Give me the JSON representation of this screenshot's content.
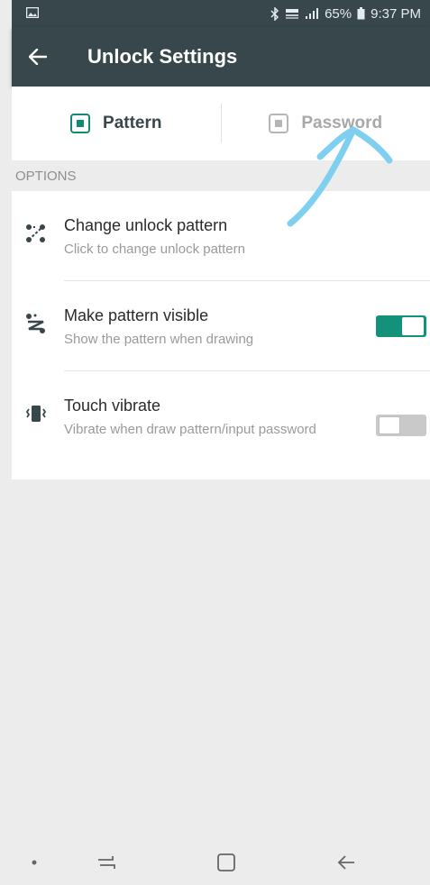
{
  "status_bar": {
    "battery": "65%",
    "time": "9:37 PM",
    "icons": [
      "gallery-icon",
      "bluetooth-icon",
      "lte-icon",
      "signal-icon",
      "battery-icon"
    ]
  },
  "app_bar": {
    "title": "Unlock Settings",
    "back_icon": "arrow-left-icon"
  },
  "tabs": [
    {
      "label": "Pattern",
      "active": true
    },
    {
      "label": "Password",
      "active": false
    }
  ],
  "section": {
    "title": "OPTIONS"
  },
  "options": [
    {
      "title": "Change unlock pattern",
      "subtitle": "Click to change unlock pattern",
      "icon": "pattern-icon"
    },
    {
      "title": "Make pattern visible",
      "subtitle": "Show the pattern when drawing",
      "icon": "pattern-visible-icon",
      "toggle": "on"
    },
    {
      "title": "Touch vibrate",
      "subtitle": "Vibrate when draw pattern/input password",
      "icon": "vibrate-icon",
      "toggle": "off"
    }
  ],
  "colors": {
    "app_bar": "#37474c",
    "accent": "#0e8a75",
    "annotation": "#7fcff0"
  },
  "nav_bar": {
    "items": [
      "dot-icon",
      "recent-apps-icon",
      "home-icon",
      "back-icon"
    ]
  }
}
